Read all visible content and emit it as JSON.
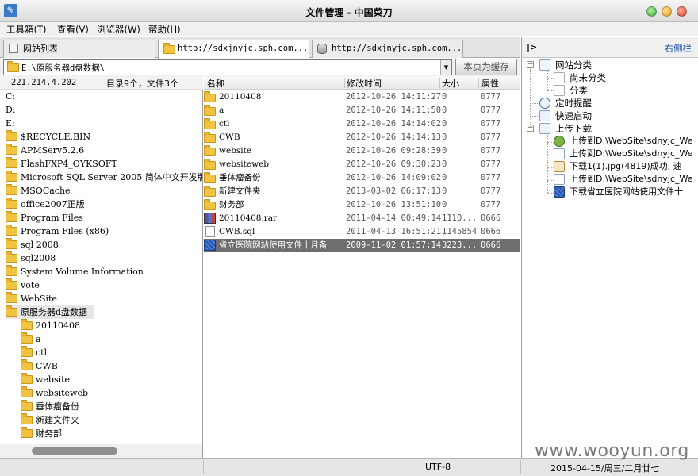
{
  "window": {
    "title": "文件管理 - 中国菜刀"
  },
  "menu": [
    "工具箱(T)",
    "查看(V)",
    "浏览器(W)",
    "帮助(H)"
  ],
  "tabs": [
    {
      "label": "网站列表"
    },
    {
      "label": "http://sdxjnyjc.sph.com...."
    },
    {
      "label": "http://sdxjnyjc.sph.com...."
    }
  ],
  "path": {
    "value": "E:\\原服务器d盘数据\\",
    "cache_button": "本页为缓存"
  },
  "info": {
    "ip": "221.214.4.202",
    "count": "目录9个，文件3个"
  },
  "tree": {
    "drives": [
      "C:",
      "D:",
      "E:"
    ],
    "folders": [
      "$RECYCLE.BIN",
      "APMServ5.2.6",
      "FlashFXP4_OYKSOFT",
      "Microsoft SQL Server 2005 简体中文开发版",
      "MSOCache",
      "office2007正版",
      "Program Files",
      "Program Files (x86)",
      "sql 2008",
      "sql2008",
      "System Volume Information",
      "vote",
      "WebSite"
    ],
    "selected": "原服务器d盘数据",
    "children": [
      "20110408",
      "a",
      "ctl",
      "CWB",
      "website",
      "websiteweb",
      "垂体瘤备份",
      "新建文件夹",
      "财务部"
    ]
  },
  "list": {
    "columns": {
      "name": "名称",
      "time": "修改时间",
      "size": "大小",
      "attr": "属性"
    },
    "rows": [
      {
        "type": "folder",
        "name": "20110408",
        "time": "2012-10-26 14:11:27",
        "size": "0",
        "attr": "0777"
      },
      {
        "type": "folder",
        "name": "a",
        "time": "2012-10-26 14:11:50",
        "size": "0",
        "attr": "0777"
      },
      {
        "type": "folder",
        "name": "ctl",
        "time": "2012-10-26 14:14:02",
        "size": "0",
        "attr": "0777"
      },
      {
        "type": "folder",
        "name": "CWB",
        "time": "2012-10-26 14:14:13",
        "size": "0",
        "attr": "0777"
      },
      {
        "type": "folder",
        "name": "website",
        "time": "2012-10-26 09:28:39",
        "size": "0",
        "attr": "0777"
      },
      {
        "type": "folder",
        "name": "websiteweb",
        "time": "2012-10-26 09:30:23",
        "size": "0",
        "attr": "0777"
      },
      {
        "type": "folder",
        "name": "垂体瘤备份",
        "time": "2012-10-26 14:09:02",
        "size": "0",
        "attr": "0777"
      },
      {
        "type": "folder",
        "name": "新建文件夹",
        "time": "2013-03-02 06:17:13",
        "size": "0",
        "attr": "0777"
      },
      {
        "type": "folder",
        "name": "财务部",
        "time": "2012-10-26 13:51:10",
        "size": "0",
        "attr": "0777"
      },
      {
        "type": "rar",
        "name": "20110408.rar",
        "time": "2011-04-14 00:49:14",
        "size": "1110...",
        "attr": "0666"
      },
      {
        "type": "file",
        "name": "CWB.sql",
        "time": "2011-04-13 16:51:21",
        "size": "1145854",
        "attr": "0666"
      },
      {
        "type": "doc",
        "name": "省立医院网站使用文件十月备",
        "time": "2009-11-02 01:57:14",
        "size": "3223...",
        "attr": "0666",
        "selected": true
      }
    ]
  },
  "sidebar": {
    "title": "右侧栏",
    "collapse": "|>",
    "site_category": "网站分类",
    "categories": [
      "尚未分类",
      "分类一"
    ],
    "timer": "定时提醒",
    "quick": "快速启动",
    "transfers": "上传下载",
    "logs": [
      "上传到D:\\WebSite\\sdnyjc_We",
      "上传到D:\\WebSite\\sdnyjc_We",
      "下载1(1).jpg(4819)成功, 速",
      "上传到D:\\WebSite\\sdnyjc_We",
      "下载省立医院网站使用文件十"
    ]
  },
  "status": {
    "encoding": "UTF-8",
    "date": "2015-04-15/周三/二月廿七"
  },
  "watermark": "www.wooyun.org"
}
